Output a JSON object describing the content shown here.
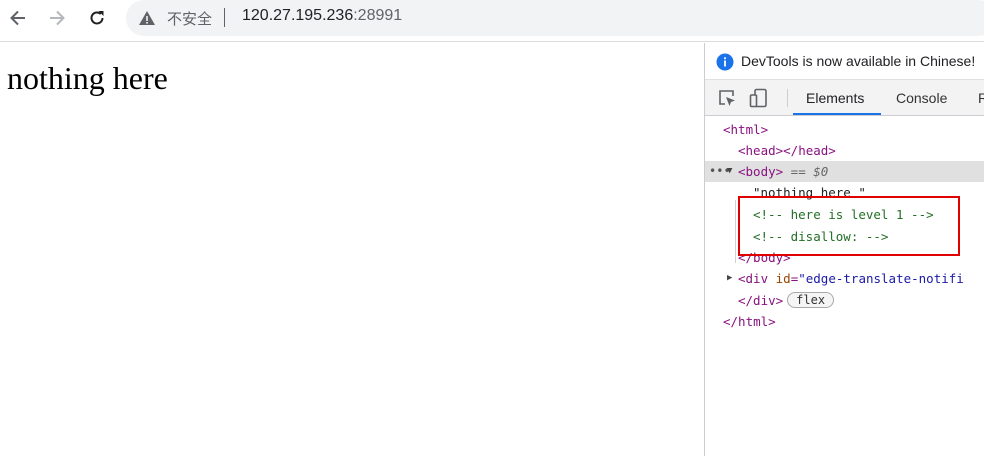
{
  "browser": {
    "security_label": "不安全",
    "url_host": "120.27.195.236",
    "url_port": ":28991",
    "icons": {
      "back": "arrow-left-icon",
      "forward": "arrow-right-icon",
      "reload": "reload-icon",
      "warning": "warning-triangle-icon"
    }
  },
  "page": {
    "text": "nothing here"
  },
  "devtools": {
    "notice": "DevTools is now available in Chinese!",
    "tabs": [
      "Elements",
      "Console",
      "R"
    ],
    "active_tab": "Elements",
    "accent_color": "#1a73e8",
    "dom": {
      "html_open": "<html>",
      "head": "<head></head>",
      "body_open": "<body>",
      "body_eq": " == $0",
      "text_node": "\"nothing here \"",
      "comment1": "<!-- here is level 1 -->",
      "comment2": "<!-- disallow: -->",
      "body_close": "</body>",
      "div_open_prefix": "<div ",
      "div_attr_name": "id",
      "div_attr_value": "\"edge-translate-notifi",
      "div_close": "</div>",
      "flex_badge": "flex",
      "html_close": "</html>"
    },
    "highlight_color": "#e00000"
  }
}
